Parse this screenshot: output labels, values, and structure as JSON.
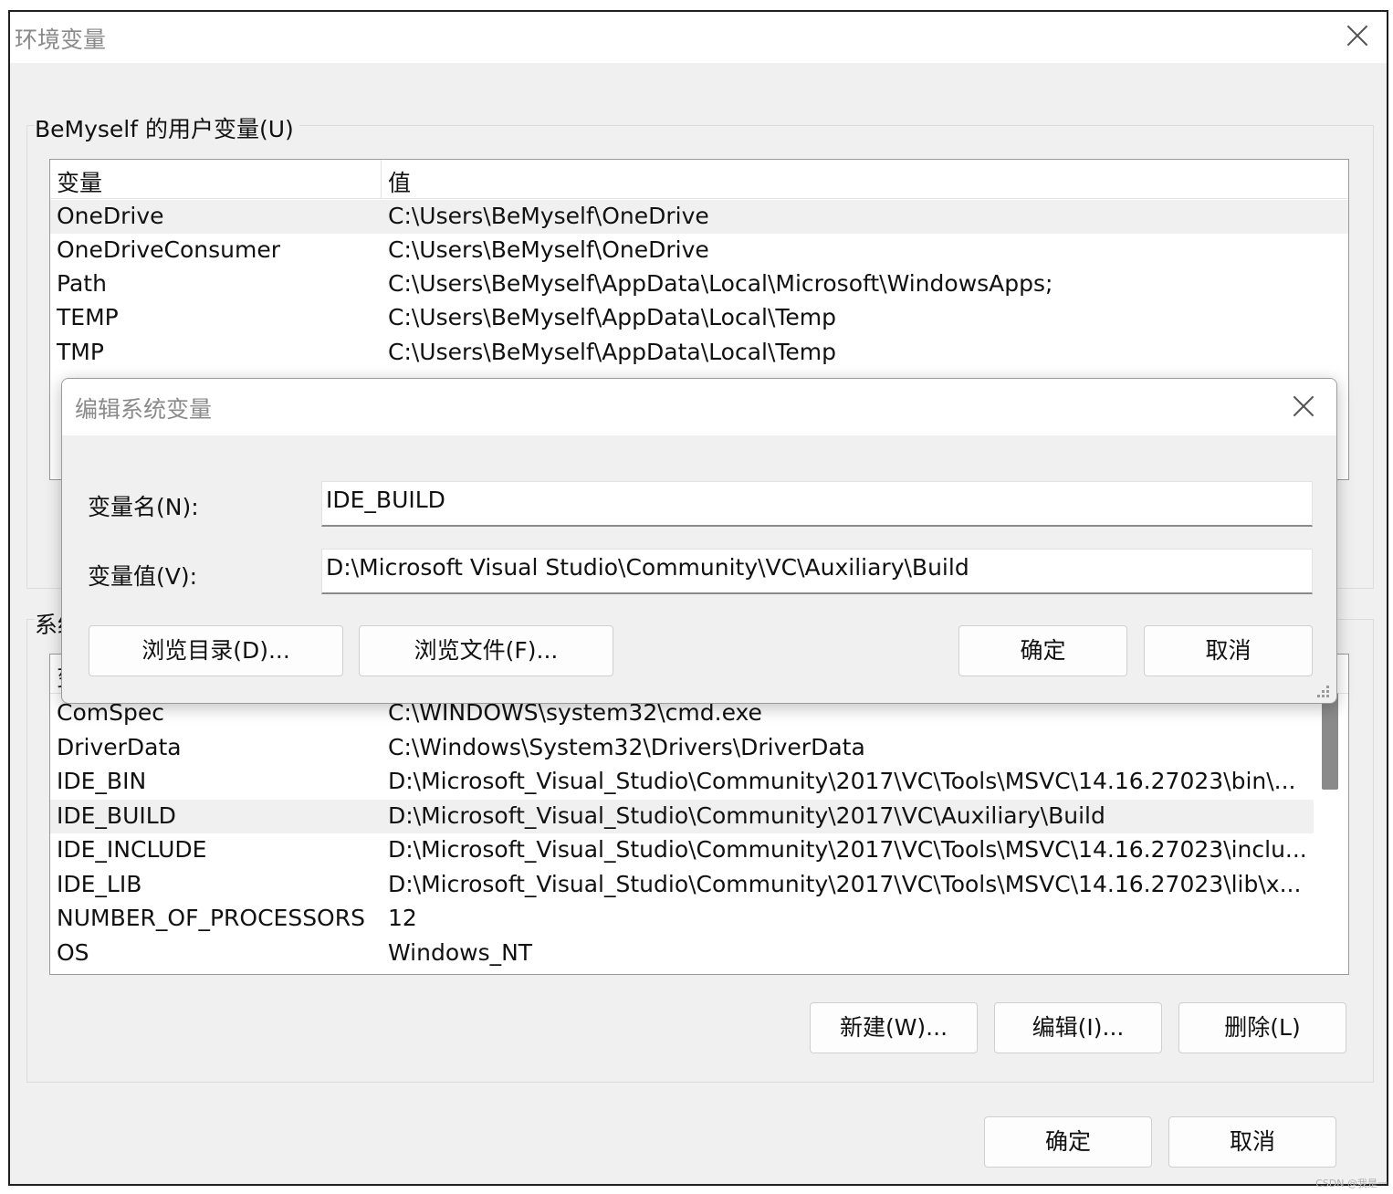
{
  "window": {
    "title": "环境变量"
  },
  "user_vars": {
    "group_label": "BeMyself 的用户变量(U)",
    "columns": [
      "变量",
      "值"
    ],
    "rows": [
      {
        "name": "OneDrive",
        "value": "C:\\Users\\BeMyself\\OneDrive"
      },
      {
        "name": "OneDriveConsumer",
        "value": "C:\\Users\\BeMyself\\OneDrive"
      },
      {
        "name": "Path",
        "value": "C:\\Users\\BeMyself\\AppData\\Local\\Microsoft\\WindowsApps;"
      },
      {
        "name": "TEMP",
        "value": "C:\\Users\\BeMyself\\AppData\\Local\\Temp"
      },
      {
        "name": "TMP",
        "value": "C:\\Users\\BeMyself\\AppData\\Local\\Temp"
      }
    ]
  },
  "system_vars": {
    "group_label": "系统变量(S)",
    "header_partial": "变",
    "rows": [
      {
        "name": "ComSpec",
        "value": "C:\\WINDOWS\\system32\\cmd.exe"
      },
      {
        "name": "DriverData",
        "value": "C:\\Windows\\System32\\Drivers\\DriverData"
      },
      {
        "name": "IDE_BIN",
        "value": "D:\\Microsoft_Visual_Studio\\Community\\2017\\VC\\Tools\\MSVC\\14.16.27023\\bin\\..."
      },
      {
        "name": "IDE_BUILD",
        "value": "D:\\Microsoft_Visual_Studio\\Community\\2017\\VC\\Auxiliary\\Build"
      },
      {
        "name": "IDE_INCLUDE",
        "value": "D:\\Microsoft_Visual_Studio\\Community\\2017\\VC\\Tools\\MSVC\\14.16.27023\\inclu..."
      },
      {
        "name": "IDE_LIB",
        "value": "D:\\Microsoft_Visual_Studio\\Community\\2017\\VC\\Tools\\MSVC\\14.16.27023\\lib\\x..."
      },
      {
        "name": "NUMBER_OF_PROCESSORS",
        "value": "12"
      },
      {
        "name": "OS",
        "value": "Windows_NT"
      }
    ],
    "buttons": {
      "new": "新建(W)...",
      "edit": "编辑(I)...",
      "delete": "删除(L)"
    }
  },
  "footer": {
    "ok": "确定",
    "cancel": "取消"
  },
  "edit_dialog": {
    "title": "编辑系统变量",
    "name_label": "变量名(N):",
    "name_value": "IDE_BUILD",
    "value_label": "变量值(V):",
    "value_value": "D:\\Microsoft Visual Studio\\Community\\VC\\Auxiliary\\Build",
    "browse_dir": "浏览目录(D)...",
    "browse_file": "浏览文件(F)...",
    "ok": "确定",
    "cancel": "取消"
  },
  "watermark": "CSDN @我是一"
}
